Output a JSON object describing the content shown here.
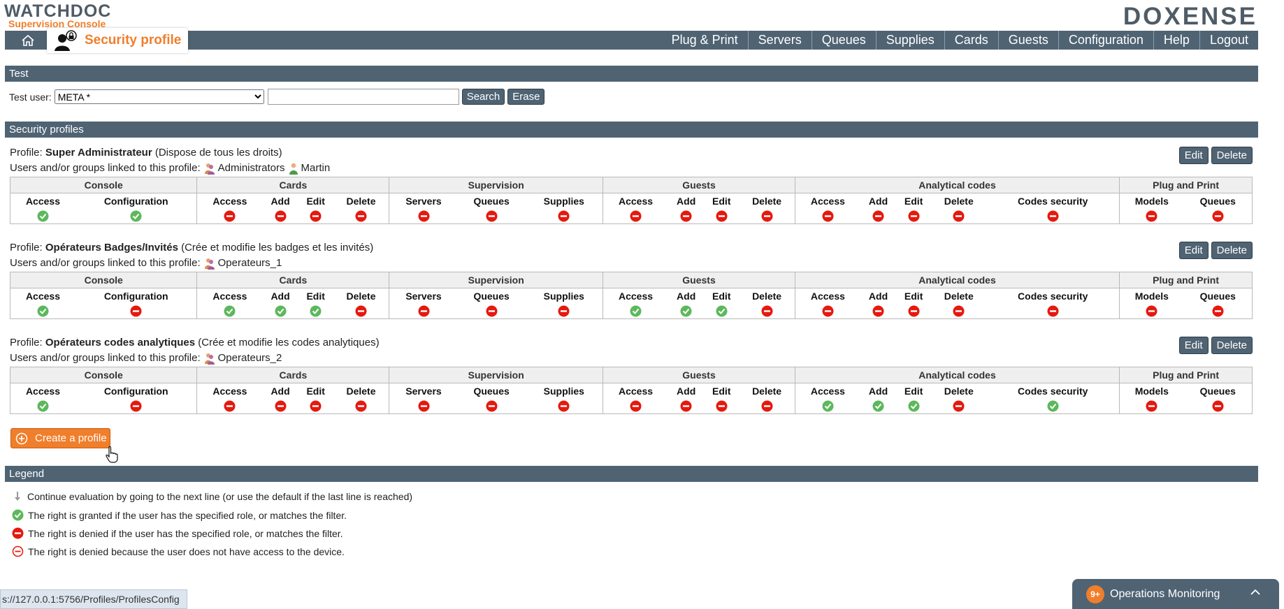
{
  "header": {
    "logo_main": "WATCHDOC",
    "logo_sub": "Supervision Console",
    "brand": "DOXENSE",
    "page_title": "Security profile"
  },
  "nav": [
    "Plug & Print",
    "Servers",
    "Queues",
    "Supplies",
    "Cards",
    "Guests",
    "Configuration",
    "Help",
    "Logout"
  ],
  "test": {
    "section_title": "Test",
    "user_label": "Test user:",
    "select_value": "META *",
    "input_value": "",
    "search_label": "Search",
    "erase_label": "Erase"
  },
  "profiles_section": {
    "title": "Security profiles",
    "profile_prefix": "Profile:",
    "users_prefix": "Users and/or groups linked to this profile:",
    "edit_label": "Edit",
    "delete_label": "Delete",
    "groups": [
      {
        "name": "Console",
        "cols": [
          "Access",
          "Configuration"
        ]
      },
      {
        "name": "Cards",
        "cols": [
          "Access",
          "Add",
          "Edit",
          "Delete"
        ]
      },
      {
        "name": "Supervision",
        "cols": [
          "Servers",
          "Queues",
          "Supplies"
        ]
      },
      {
        "name": "Guests",
        "cols": [
          "Access",
          "Add",
          "Edit",
          "Delete"
        ]
      },
      {
        "name": "Analytical codes",
        "cols": [
          "Access",
          "Add",
          "Edit",
          "Delete",
          "Codes security"
        ]
      },
      {
        "name": "Plug and Print",
        "cols": [
          "Models",
          "Queues"
        ]
      }
    ]
  },
  "profiles": [
    {
      "name": "Super Administrateur",
      "desc": "(Dispose de tous les droits)",
      "users": [
        {
          "name": "Administrators",
          "icon": "group-icon"
        },
        {
          "name": "Martin",
          "icon": "user-icon"
        }
      ],
      "rights": [
        "granted",
        "granted",
        "denied",
        "denied",
        "denied",
        "denied",
        "denied",
        "denied",
        "denied",
        "denied",
        "denied",
        "denied",
        "denied",
        "denied",
        "denied",
        "denied",
        "denied",
        "denied",
        "denied",
        "denied"
      ]
    },
    {
      "name": "Opérateurs Badges/Invités",
      "desc": "(Crée et modifie les badges et les invités)",
      "users": [
        {
          "name": "Operateurs_1",
          "icon": "group-icon"
        }
      ],
      "rights": [
        "granted",
        "denied",
        "granted",
        "granted",
        "granted",
        "denied",
        "denied",
        "denied",
        "denied",
        "granted",
        "granted",
        "granted",
        "denied",
        "denied",
        "denied",
        "denied",
        "denied",
        "denied",
        "denied",
        "denied"
      ]
    },
    {
      "name": "Opérateurs codes analytiques",
      "desc": "(Crée et modifie les codes analytiques)",
      "users": [
        {
          "name": "Operateurs_2",
          "icon": "group-icon"
        }
      ],
      "rights": [
        "granted",
        "denied",
        "denied",
        "denied",
        "denied",
        "denied",
        "denied",
        "denied",
        "denied",
        "denied",
        "denied",
        "denied",
        "denied",
        "granted",
        "granted",
        "granted",
        "denied",
        "granted",
        "denied",
        "denied"
      ]
    }
  ],
  "create_label": "Create a profile",
  "legend": {
    "title": "Legend",
    "items": [
      {
        "icon": "arrow-down-icon",
        "text": "Continue evaluation by going to the next line (or use the default if the last line is reached)"
      },
      {
        "icon": "granted-icon",
        "text": "The right is granted if the user has the specified role, or matches the filter."
      },
      {
        "icon": "denied-icon",
        "text": "The right is denied if the user has the specified role, or matches the filter."
      },
      {
        "icon": "denied-no-access-icon",
        "text": "The right is denied because the user does not have access to the device."
      }
    ]
  },
  "status_url": "s://127.0.0.1:5756/Profiles/ProfilesConfig",
  "ops": {
    "badge": "9+",
    "label": "Operations Monitoring"
  },
  "colors": {
    "accent": "#f07e2b",
    "bar": "#4f6373",
    "granted": "#5cb85c",
    "denied": "#e5190f"
  }
}
